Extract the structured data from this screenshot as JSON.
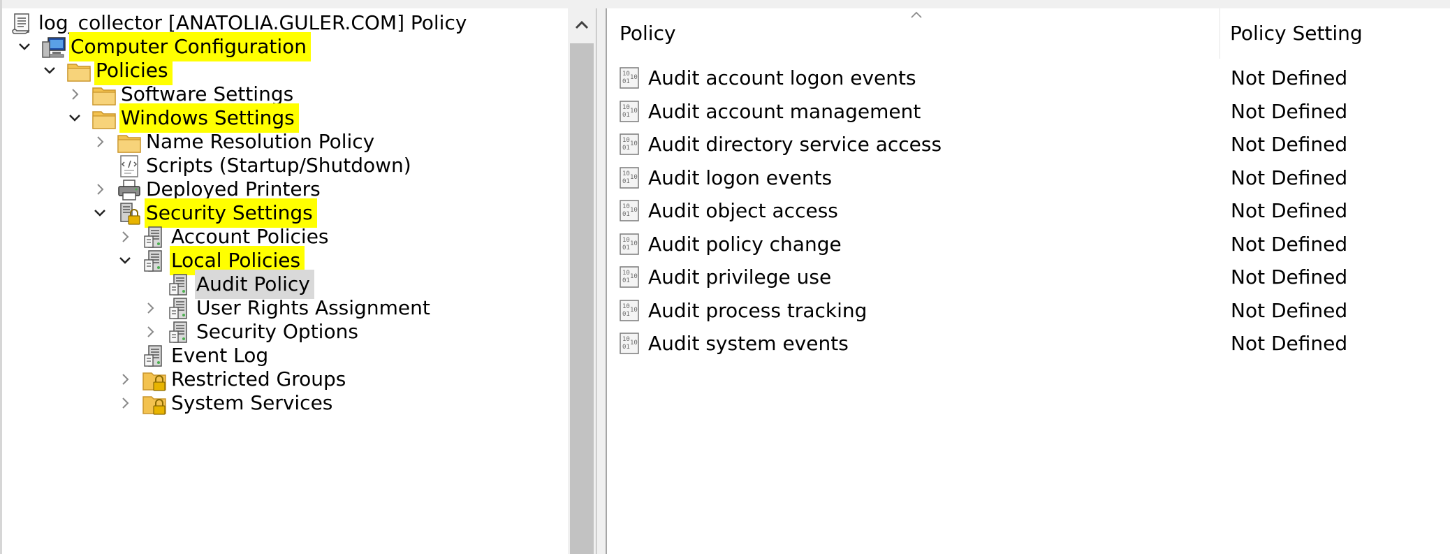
{
  "tree": {
    "items": [
      {
        "label": "log_collector [ANATOLIA.GULER.COM] Policy",
        "icon": "policy-scroll-icon",
        "expander": "none",
        "highlight": false,
        "selected": false
      },
      {
        "label": "Computer Configuration",
        "icon": "computer-icon",
        "expander": "expanded",
        "highlight": true,
        "selected": false
      },
      {
        "label": "Policies",
        "icon": "folder-icon",
        "expander": "expanded",
        "highlight": true,
        "selected": false
      },
      {
        "label": "Software Settings",
        "icon": "folder-icon",
        "expander": "collapsed",
        "highlight": false,
        "selected": false
      },
      {
        "label": "Windows Settings",
        "icon": "folder-icon",
        "expander": "expanded",
        "highlight": true,
        "selected": false
      },
      {
        "label": "Name Resolution Policy",
        "icon": "folder-icon",
        "expander": "collapsed",
        "highlight": false,
        "selected": false
      },
      {
        "label": "Scripts (Startup/Shutdown)",
        "icon": "script-icon",
        "expander": "none",
        "highlight": false,
        "selected": false
      },
      {
        "label": "Deployed Printers",
        "icon": "printer-icon",
        "expander": "collapsed",
        "highlight": false,
        "selected": false
      },
      {
        "label": "Security Settings",
        "icon": "security-settings-icon",
        "expander": "expanded",
        "highlight": true,
        "selected": false
      },
      {
        "label": "Account Policies",
        "icon": "policy-server-icon",
        "expander": "collapsed",
        "highlight": false,
        "selected": false
      },
      {
        "label": "Local Policies",
        "icon": "policy-server-icon",
        "expander": "expanded",
        "highlight": true,
        "selected": false
      },
      {
        "label": "Audit Policy",
        "icon": "policy-server-icon",
        "expander": "none",
        "highlight": false,
        "selected": true
      },
      {
        "label": "User Rights Assignment",
        "icon": "policy-server-icon",
        "expander": "collapsed",
        "highlight": false,
        "selected": false
      },
      {
        "label": "Security Options",
        "icon": "policy-server-icon",
        "expander": "collapsed",
        "highlight": false,
        "selected": false
      },
      {
        "label": "Event Log",
        "icon": "policy-server-icon",
        "expander": "none",
        "highlight": false,
        "selected": false
      },
      {
        "label": "Restricted Groups",
        "icon": "locked-folder-icon",
        "expander": "collapsed",
        "highlight": false,
        "selected": false
      },
      {
        "label": "System Services",
        "icon": "locked-folder-icon",
        "expander": "collapsed",
        "highlight": false,
        "selected": false
      }
    ]
  },
  "list": {
    "columns": {
      "policy": "Policy",
      "setting": "Policy Setting"
    },
    "sort_indicator": "ascending",
    "rows": [
      {
        "policy": "Audit account logon events",
        "setting": "Not Defined"
      },
      {
        "policy": "Audit account management",
        "setting": "Not Defined"
      },
      {
        "policy": "Audit directory service access",
        "setting": "Not Defined"
      },
      {
        "policy": "Audit logon events",
        "setting": "Not Defined"
      },
      {
        "policy": "Audit object access",
        "setting": "Not Defined"
      },
      {
        "policy": "Audit policy change",
        "setting": "Not Defined"
      },
      {
        "policy": "Audit privilege use",
        "setting": "Not Defined"
      },
      {
        "policy": "Audit process tracking",
        "setting": "Not Defined"
      },
      {
        "policy": "Audit system events",
        "setting": "Not Defined"
      }
    ]
  },
  "colors": {
    "highlight": "#ffff00",
    "selection": "#d9d9d9",
    "folder": "#f3c24f"
  }
}
